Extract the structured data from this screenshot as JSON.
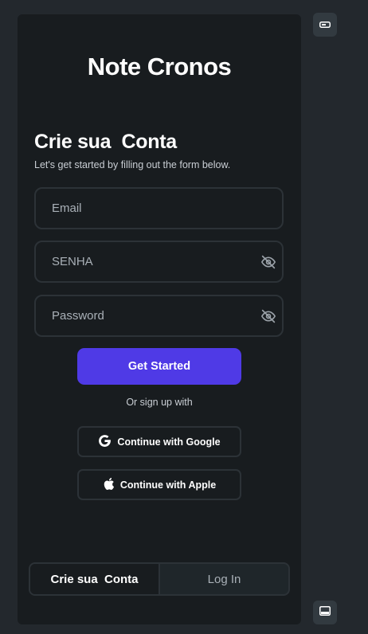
{
  "app": {
    "title": "Note Cronos"
  },
  "form": {
    "heading": "Crie sua  Conta",
    "subtitle": "Let's get started by filling out the form below.",
    "email_placeholder": "Email",
    "senha_placeholder": "SENHA",
    "password_placeholder": "Password",
    "submit_label": "Get Started",
    "or_text": "Or sign up with",
    "google_label": "Continue with Google",
    "apple_label": "Continue with Apple"
  },
  "tabs": [
    {
      "label": "Crie sua  Conta",
      "active": true
    },
    {
      "label": "Log In",
      "active": false
    }
  ],
  "icons": {
    "eye_off": "eye-off-icon",
    "google": "google-icon",
    "apple": "apple-icon",
    "toggle": "toggle-icon",
    "panel": "panel-icon"
  },
  "colors": {
    "background": "#23282d",
    "card": "#181c1f",
    "primary": "#4f3ae6",
    "border": "#2c3237",
    "muted_text": "#a9b0b7"
  }
}
